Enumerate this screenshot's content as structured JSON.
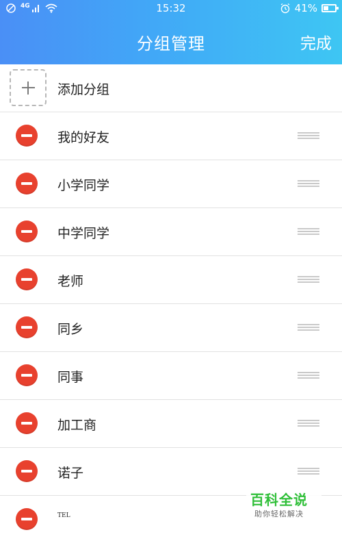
{
  "status_bar": {
    "network": "4G",
    "time": "15:32",
    "battery": "41%",
    "battery_level": 0.41,
    "icons": [
      "no-disturb-icon",
      "signal-icon",
      "wifi-icon",
      "alarm-icon",
      "battery-icon"
    ]
  },
  "nav": {
    "title": "分组管理",
    "done_label": "完成"
  },
  "add_group": {
    "label": "添加分组",
    "icon": "plus-icon"
  },
  "groups": [
    {
      "label": "我的好友"
    },
    {
      "label": "小学同学"
    },
    {
      "label": "中学同学"
    },
    {
      "label": "老师"
    },
    {
      "label": "同乡"
    },
    {
      "label": "同事"
    },
    {
      "label": "加工商"
    },
    {
      "label": "诺子"
    },
    {
      "label": "TEL"
    }
  ],
  "colors": {
    "header_start": "#4a8ff6",
    "header_end": "#3ec6f3",
    "delete": "#e8412e",
    "watermark": "#2fbf38"
  },
  "watermark": {
    "title": "百科全说",
    "subtitle": "助你轻松解决"
  }
}
